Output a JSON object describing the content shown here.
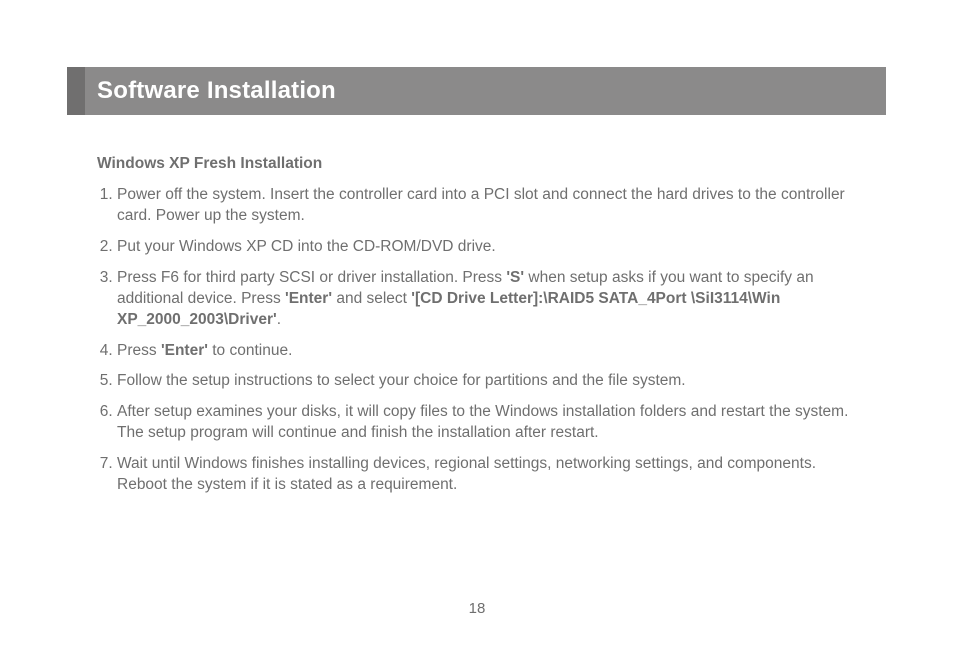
{
  "banner": {
    "title": "Software Installation"
  },
  "section": {
    "subheading": "Windows XP Fresh Installation"
  },
  "steps": [
    {
      "segments": [
        {
          "t": "Power off the system. Insert the controller card into a PCI slot and connect the hard drives to the controller card. Power up the system.",
          "b": false
        }
      ]
    },
    {
      "segments": [
        {
          "t": "Put your Windows XP CD into the CD-ROM/DVD drive.",
          "b": false
        }
      ]
    },
    {
      "segments": [
        {
          "t": "Press F6 for third party SCSI or driver installation. Press ",
          "b": false
        },
        {
          "t": "'S'",
          "b": true
        },
        {
          "t": " when setup asks if you want to specify an additional device. Press ",
          "b": false
        },
        {
          "t": "'Enter'",
          "b": true
        },
        {
          "t": " and select ",
          "b": false
        },
        {
          "t": "'[CD Drive Letter]:\\RAID5 SATA_4Port \\SiI3114\\Win XP_2000_2003\\Driver'",
          "b": true
        },
        {
          "t": ".",
          "b": false
        }
      ]
    },
    {
      "segments": [
        {
          "t": "Press ",
          "b": false
        },
        {
          "t": "'Enter'",
          "b": true
        },
        {
          "t": " to continue.",
          "b": false
        }
      ]
    },
    {
      "segments": [
        {
          "t": "Follow the setup instructions to select your choice for partitions and the file system.",
          "b": false
        }
      ]
    },
    {
      "segments": [
        {
          "t": "After setup examines your disks, it will copy files to the Windows installation folders and restart the system. The setup program will continue and finish the installation after restart.",
          "b": false
        }
      ]
    },
    {
      "segments": [
        {
          "t": "Wait until Windows finishes installing devices, regional settings, networking settings, and components.  Reboot the system if it is stated as a requirement.",
          "b": false
        }
      ]
    }
  ],
  "page_number": "18"
}
